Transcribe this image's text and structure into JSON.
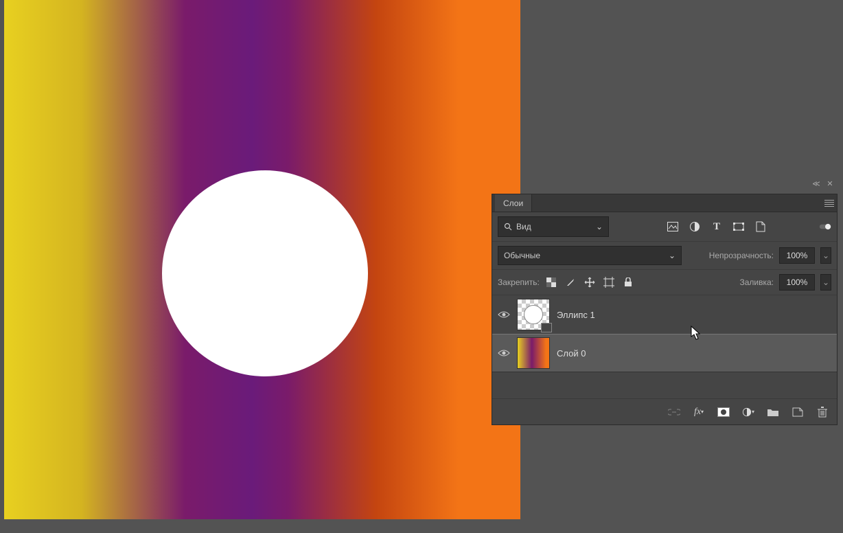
{
  "panel": {
    "title": "Слои",
    "search_label": "Вид",
    "blend_mode": "Обычные",
    "opacity_label": "Непрозрачность:",
    "opacity_value": "100%",
    "lock_label": "Закрепить:",
    "fill_label": "Заливка:",
    "fill_value": "100%"
  },
  "layers": [
    {
      "name": "Эллипс 1",
      "selected": false,
      "type": "shape"
    },
    {
      "name": "Слой 0",
      "selected": true,
      "type": "raster"
    }
  ],
  "icons": {
    "search": "search-icon",
    "image_filter": "image-filon",
    "adjust_filter": "adjust-icon",
    "text_filter": "text-icon",
    "shape_filter": "shape-icon",
    "smart_filter": "smart-object-icon"
  }
}
